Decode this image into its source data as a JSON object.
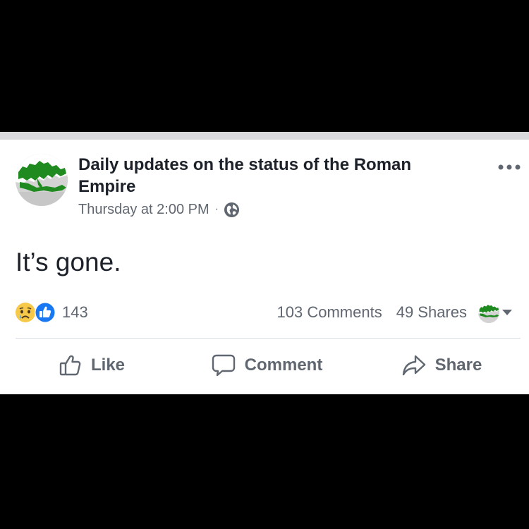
{
  "post": {
    "page_name": "Daily updates on the status of the Roman Empire",
    "timestamp": "Thursday at 2:00 PM",
    "separator": "·",
    "privacy_icon": "globe-icon",
    "text": "It’s gone.",
    "more_icon": "more-options-icon"
  },
  "stats": {
    "reaction_icons": [
      "sad-reaction-icon",
      "like-reaction-icon"
    ],
    "reaction_count": "143",
    "comments": "103 Comments",
    "shares": "49 Shares"
  },
  "actions": [
    {
      "label": "Like",
      "icon": "thumbs-up-icon"
    },
    {
      "label": "Comment",
      "icon": "comment-bubble-icon"
    },
    {
      "label": "Share",
      "icon": "share-arrow-icon"
    }
  ],
  "colors": {
    "text": "#1d2129",
    "secondary": "#616770",
    "like_blue": "#1877f2",
    "sad_yellow": "#f7c948",
    "map_green": "#1f8a1f"
  }
}
